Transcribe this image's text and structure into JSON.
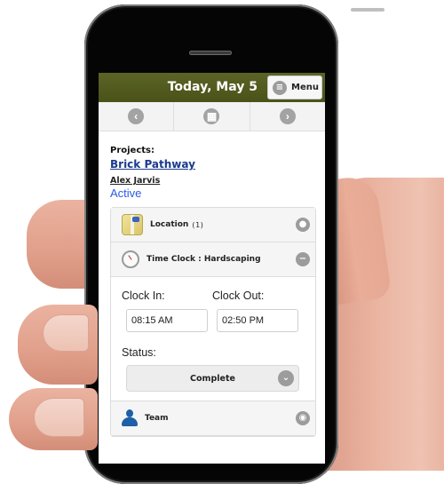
{
  "header": {
    "title": "Today, May 5",
    "menu_label": "Menu",
    "menu_icon": "list-icon"
  },
  "navbar": {
    "prev_icon": "‹",
    "calendar_icon": "▦",
    "next_icon": "›"
  },
  "project": {
    "label": "Projects:",
    "name": "Brick Pathway",
    "person": "Alex Jarvis",
    "status": "Active"
  },
  "sections": {
    "location": {
      "label": "Location",
      "count": "(1)",
      "icon": "pin-icon"
    },
    "time_clock": {
      "label": "Time Clock : Hardscaping",
      "icon": "minus-icon"
    },
    "team": {
      "label": "Team",
      "icon": "user-icon"
    }
  },
  "time_clock": {
    "clock_in_label": "Clock In:",
    "clock_in_value": "08:15 AM",
    "clock_out_label": "Clock Out:",
    "clock_out_value": "02:50 PM",
    "status_label": "Status:",
    "status_value": "Complete"
  },
  "colors": {
    "header_bg": "#4f5720",
    "link_blue": "#1b3a8c",
    "active_blue": "#2a5ae6",
    "team_icon": "#1f5fa8"
  }
}
